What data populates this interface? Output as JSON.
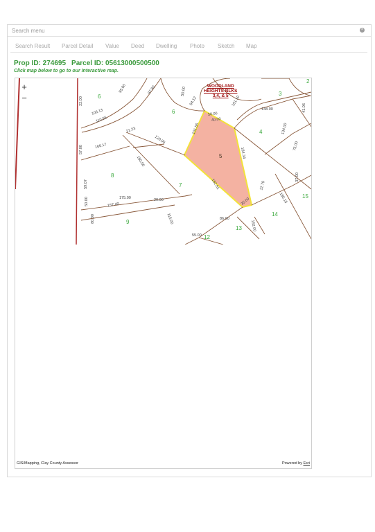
{
  "search": {
    "placeholder": "Search menu"
  },
  "tabs": [
    {
      "label": "Search Result"
    },
    {
      "label": "Parcel Detail"
    },
    {
      "label": "Value"
    },
    {
      "label": "Deed"
    },
    {
      "label": "Dwelling"
    },
    {
      "label": "Photo"
    },
    {
      "label": "Sketch"
    },
    {
      "label": "Map"
    }
  ],
  "ids": {
    "prop": "Prop ID: 274695",
    "parcel": "Parcel ID: 05613000500500"
  },
  "hint": "Click map below to go to our Interactive map.",
  "map": {
    "zoom_in": "+",
    "zoom_out": "−",
    "subdivision_title": [
      "WOODLAND",
      "HEIGHTS BLKS",
      "3,4, & 5"
    ],
    "lots": [
      "3",
      "4",
      "5",
      "6",
      "6",
      "7",
      "8",
      "9",
      "12",
      "13",
      "14",
      "15",
      "2"
    ],
    "dimensions": [
      "50.00",
      "40.00",
      "101.56",
      "184.34",
      "162.61",
      "35.00",
      "175.00",
      "20.00",
      "150.00",
      "120.00",
      "148.00",
      "115.00",
      "86.00",
      "55.00",
      "152.00",
      "157.40",
      "22.00",
      "106.13",
      "95.00",
      "87.80",
      "50.00",
      "101.10",
      "134.00",
      "166.17",
      "57.00",
      "59.07",
      "21.23",
      "75.00",
      "12.79",
      "80.00",
      "50.00",
      "110.55",
      "84.12",
      "180.15",
      "41.06",
      "37.00"
    ],
    "credit": "GIS/Mapping, Clay County Assessor",
    "powered_prefix": "Powered by ",
    "powered_brand": "Esri",
    "highlight_color": "#f4b2a2",
    "highlight_border": "#f2e23a",
    "parcel_line_color": "#8a5a3c",
    "label_color": "#3aa83c"
  }
}
